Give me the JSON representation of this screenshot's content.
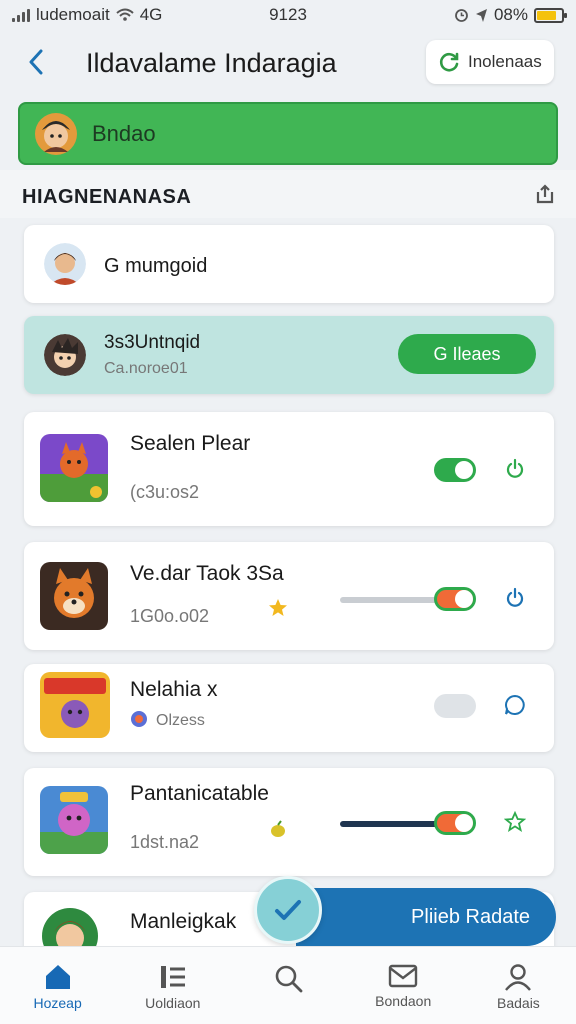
{
  "status_bar": {
    "carrier": "ludemoait",
    "network": "4G",
    "time": "9123",
    "battery": "08%",
    "battery_level": 0.8
  },
  "header": {
    "title": "Ildavalame Indaragia",
    "action_label": "Inolenaas"
  },
  "banner": {
    "label": "Bndao"
  },
  "section": {
    "title": "HIAGNENANASA"
  },
  "user_row": {
    "name": "G mumgoid"
  },
  "highlight_row": {
    "title": "3s3Untnqid",
    "subtitle": "Ca.noroe01",
    "button_label": "G Ileaes"
  },
  "items": [
    {
      "title": "Sealen Plear",
      "subtitle": "(c3u:os2",
      "toggle_on": true
    },
    {
      "title": "Ve.dar Taok 3Sa",
      "subtitle": "1G0o.o02",
      "toggle_on": true,
      "slider_value": 0.8
    },
    {
      "title": "Nelahia x",
      "subtitle": "Olzess",
      "toggle_on": false
    },
    {
      "title": "Pantanicatable",
      "subtitle": "1dst.na2",
      "toggle_on": true,
      "slider_value": 0.8
    },
    {
      "title": "Manleigkak"
    }
  ],
  "cta": {
    "label": "Pliieb Radate"
  },
  "tabs": [
    {
      "label": "Hozeap"
    },
    {
      "label": "Uoldiaon"
    },
    {
      "label": ""
    },
    {
      "label": "Bondaon"
    },
    {
      "label": "Badais"
    }
  ],
  "colors": {
    "accent_green": "#41b655",
    "brand_blue": "#1d73b4",
    "highlight_bg": "#bfe4e0",
    "toggle_orange": "#f06a37"
  }
}
